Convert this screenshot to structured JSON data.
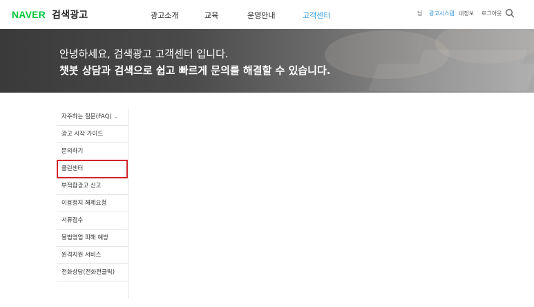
{
  "header": {
    "brand": "NAVER",
    "brand_sub": "검색광고",
    "nav": [
      "광고소개",
      "교육",
      "운영안내",
      "고객센터"
    ],
    "active_nav": "고객센터",
    "util": {
      "user_suffix": "님",
      "ad_system": "광고시스템",
      "my_info": "내정보",
      "logout": "로그아웃"
    }
  },
  "hero": {
    "line1": "안녕하세요, 검색광고 고객센터 입니다.",
    "line2": "챗봇 상담과 검색으로 쉽고 빠르게 문의를 해결할 수 있습니다."
  },
  "sidebar": {
    "items": [
      {
        "label": "자주하는 질문(FAQ)"
      },
      {
        "label": "광고 시작 가이드"
      },
      {
        "label": "문의하기"
      },
      {
        "label": "클린센터"
      },
      {
        "label": "부적합광고 신고"
      },
      {
        "label": "이용정지 해제요청"
      },
      {
        "label": "서류접수"
      },
      {
        "label": "불법영업 피해 예방"
      },
      {
        "label": "원격지원 서비스"
      },
      {
        "label": "전화상담(전화전클릭)"
      }
    ]
  }
}
